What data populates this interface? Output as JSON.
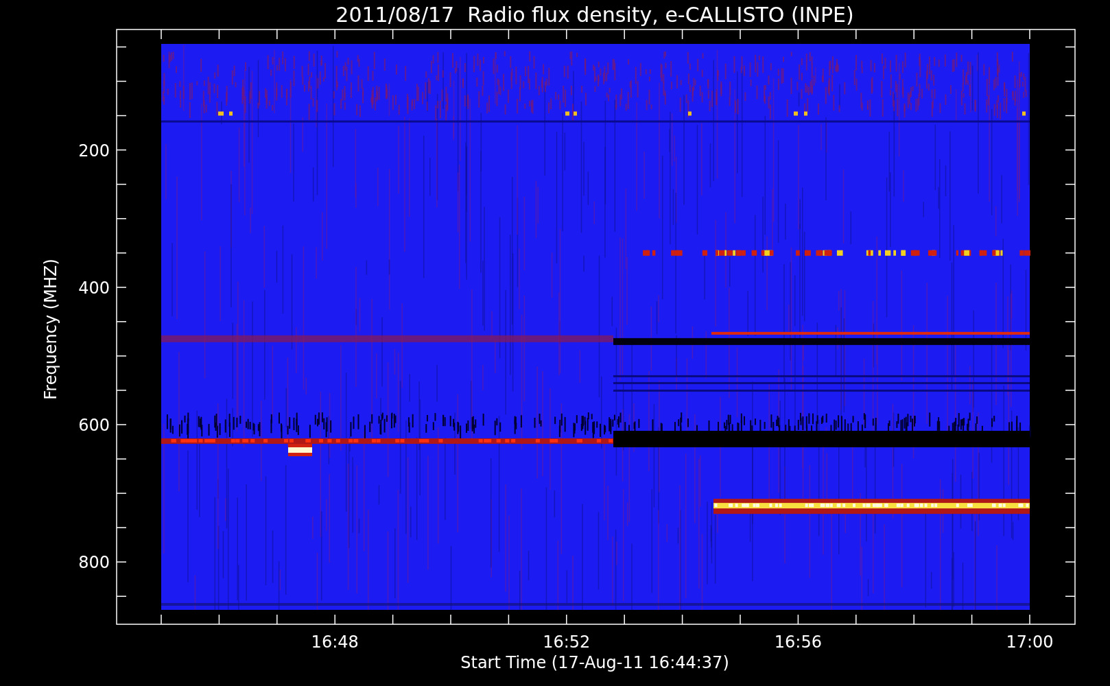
{
  "title": "2011/08/17  Radio flux density, e-CALLISTO (INPE)",
  "y_axis": {
    "label": "Frequency (MHZ)",
    "ticks": [
      "200",
      "400",
      "600",
      "800"
    ]
  },
  "x_axis": {
    "label": "Start Time (17-Aug-11 16:44:37)",
    "ticks": [
      "16:48",
      "16:52",
      "16:56",
      "17:00"
    ]
  }
}
